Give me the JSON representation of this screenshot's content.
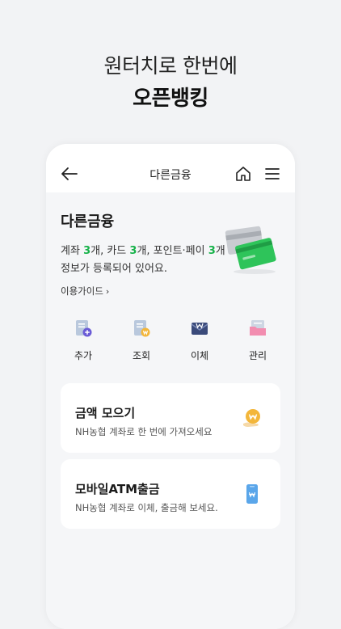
{
  "promo": {
    "line1": "원터치로 한번에",
    "line2": "오픈뱅킹"
  },
  "appbar": {
    "title": "다른금융"
  },
  "summary": {
    "heading": "다른금융",
    "t1": "계좌 ",
    "n1": "3",
    "t2": "개, 카드 ",
    "n2": "3",
    "t3": "개, 포인트·페이 ",
    "n3": "3",
    "t4": "개",
    "line2": "정보가 등록되어 있어요.",
    "guide": "이용가이드"
  },
  "actions": [
    {
      "label": "추가"
    },
    {
      "label": "조회"
    },
    {
      "label": "이체"
    },
    {
      "label": "관리"
    }
  ],
  "cards": [
    {
      "title": "금액 모으기",
      "subtitle": "NH농협 계좌로 한 번에 가져오세요"
    },
    {
      "title": "모바일ATM출금",
      "subtitle": "NH농협 계좌로 이체, 출금해 보세요."
    }
  ],
  "colors": {
    "accent_green": "#17b24a",
    "gold": "#f3b63a",
    "blue": "#5aa6ea",
    "pink": "#f28db0"
  }
}
